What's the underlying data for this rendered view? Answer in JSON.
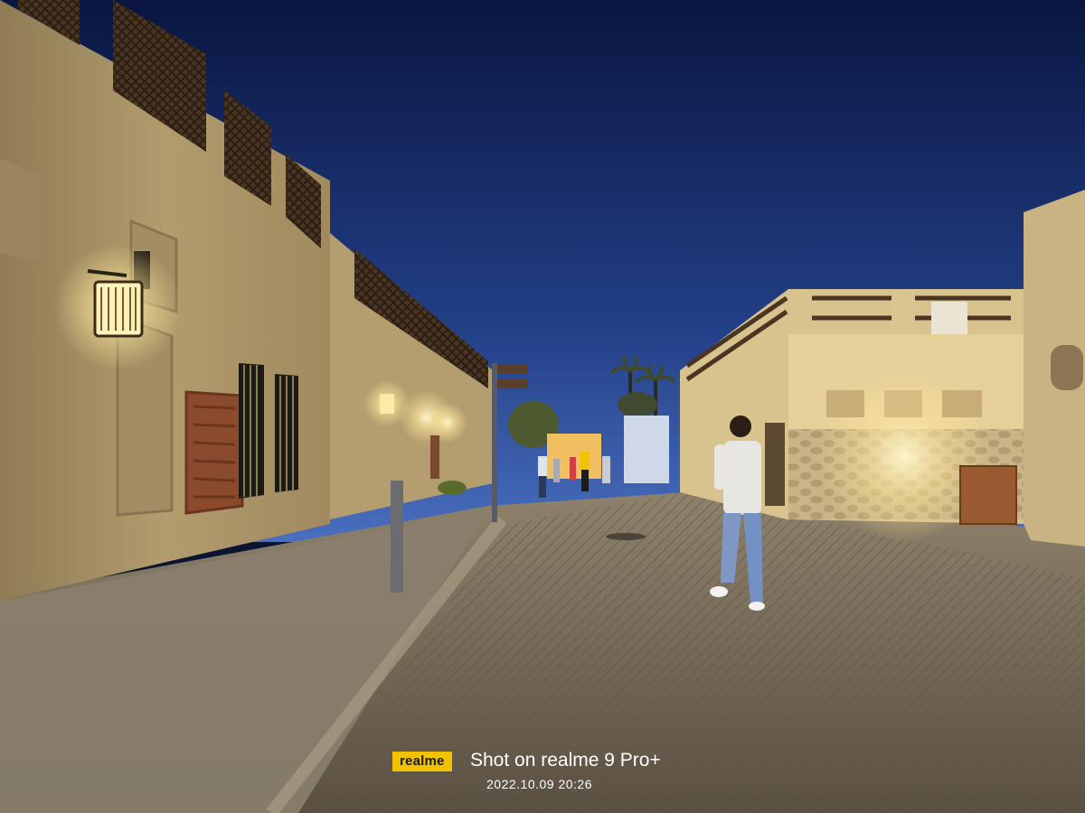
{
  "photo": {
    "scene": "night-street-old-town",
    "palette": {
      "sky_top": "#0c1a46",
      "sky_bottom": "#3a5fb0",
      "wall_light": "#c8b184",
      "wall_shadow": "#6e5e3e",
      "pavement": "#7a6e5c",
      "lamp_glow": "#fff3c0"
    }
  },
  "watermark": {
    "brand": "realme",
    "shot_on": "Shot on realme 9 Pro+",
    "timestamp": "2022.10.09 20:26",
    "brand_color": "#f2c200"
  }
}
